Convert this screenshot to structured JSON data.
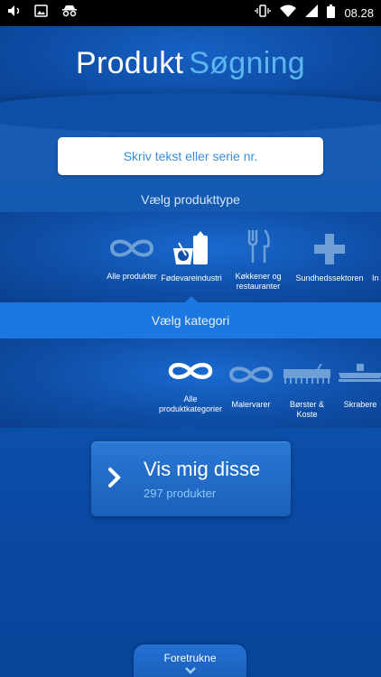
{
  "status_bar": {
    "time": "08.28",
    "left_icons": [
      "volume-icon",
      "image-icon",
      "incognito-icon"
    ],
    "right_icons": [
      "vibrate-icon",
      "wifi-icon",
      "signal-icon",
      "battery-icon"
    ]
  },
  "header": {
    "title_word1": "Produkt",
    "title_word2": "Søgning"
  },
  "search": {
    "placeholder": "Skriv tekst eller serie nr."
  },
  "product_type": {
    "heading": "Vælg produkttype",
    "items": [
      {
        "label": "Alle produkter",
        "icon": "infinity-icon"
      },
      {
        "label": "Fødevareindustri",
        "icon": "food-industry-icon"
      },
      {
        "label": "Køkkener og restauranter",
        "icon": "fork-knife-icon"
      },
      {
        "label": "Sundhedssektoren",
        "icon": "medical-cross-icon"
      },
      {
        "label": "In",
        "icon": ""
      }
    ]
  },
  "category": {
    "heading": "Vælg kategori",
    "items": [
      {
        "label": "Alle produktkategorier",
        "icon": "infinity-icon"
      },
      {
        "label": "Malervarer",
        "icon": "infinity-icon"
      },
      {
        "label": "Børster & Koste",
        "icon": "brush-icon"
      },
      {
        "label": "Skrabere",
        "icon": "squeegee-icon"
      }
    ]
  },
  "cta": {
    "title": "Vis mig disse",
    "subtitle": "297 produkter",
    "icon": "chevron-right-icon"
  },
  "favorites": {
    "label": "Foretrukne",
    "icon": "chevron-down-icon"
  },
  "colors": {
    "accent_light_blue": "#5bb5f0",
    "selected_bar": "#1a78e0",
    "background": "#0a4a9e"
  }
}
